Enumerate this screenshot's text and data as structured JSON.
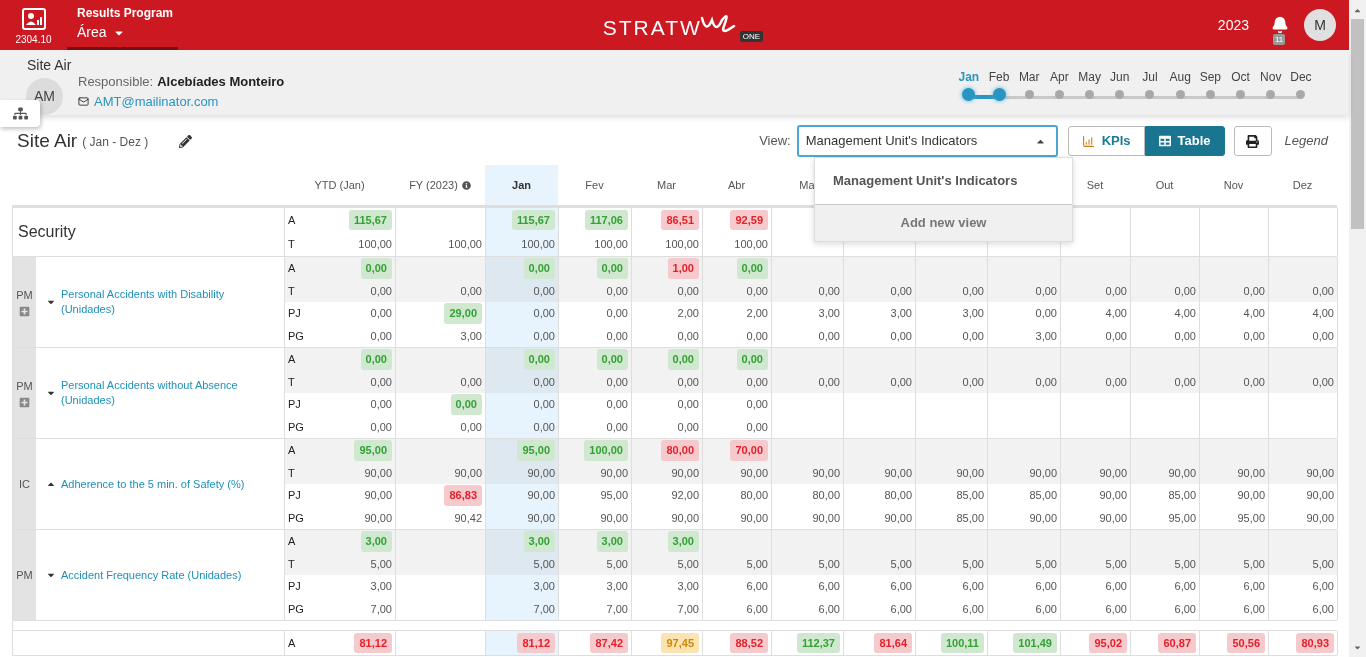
{
  "header": {
    "app_code": "2304.10",
    "program": "Results Program",
    "area": "Área",
    "logo_text": "STRATW",
    "logo_badge": "ONE",
    "year": "2023",
    "notifications": "11",
    "user_initial": "M"
  },
  "unit": {
    "name": "Site Air",
    "initials": "AM",
    "responsible_label": "Responsible:",
    "responsible": "Alcebíades Monteiro",
    "email": "AMT@mailinator.com"
  },
  "timeline": [
    {
      "label": "Jan",
      "selected": true,
      "in_range": true
    },
    {
      "label": "Feb",
      "selected": false,
      "in_range": true
    },
    {
      "label": "Mar",
      "selected": false,
      "in_range": false
    },
    {
      "label": "Apr",
      "selected": false,
      "in_range": false
    },
    {
      "label": "May",
      "selected": false,
      "in_range": false
    },
    {
      "label": "Jun",
      "selected": false,
      "in_range": false
    },
    {
      "label": "Jul",
      "selected": false,
      "in_range": false
    },
    {
      "label": "Aug",
      "selected": false,
      "in_range": false
    },
    {
      "label": "Sep",
      "selected": false,
      "in_range": false
    },
    {
      "label": "Oct",
      "selected": false,
      "in_range": false
    },
    {
      "label": "Nov",
      "selected": false,
      "in_range": false
    },
    {
      "label": "Dec",
      "selected": false,
      "in_range": false
    }
  ],
  "page": {
    "title": "Site Air",
    "period": "( Jan - Dez )"
  },
  "view": {
    "label": "View:",
    "value": "Management Unit's Indicators",
    "expanded": true,
    "options": [
      "Management Unit's Indicators"
    ],
    "add_label": "Add new view"
  },
  "modes": [
    {
      "label": "KPIs",
      "kind": "kpis",
      "selected": false
    },
    {
      "label": "Table",
      "kind": "table",
      "selected": true
    }
  ],
  "legend": "Legend",
  "table": {
    "columns": [
      {
        "label": "YTD (Jan)",
        "selected": false
      },
      {
        "label": "FY (2023)",
        "selected": false,
        "info": true
      },
      {
        "label": "Jan",
        "selected": true
      },
      {
        "label": "Fev",
        "selected": false
      },
      {
        "label": "Mar",
        "selected": false
      },
      {
        "label": "Abr",
        "selected": false
      },
      {
        "label": "Ma",
        "selected": false
      },
      {
        "selected": false
      },
      {
        "selected": false
      },
      {
        "selected": false
      },
      {
        "label": "Set",
        "selected": false
      },
      {
        "label": "Out",
        "selected": false
      },
      {
        "label": "Nov",
        "selected": false
      },
      {
        "label": "Dez",
        "selected": false
      }
    ],
    "blocks": [
      {
        "kind": "group",
        "name": "Security",
        "rows": [
          {
            "label": "A",
            "cells": [
              {
                "v": "115,67",
                "kind": "good"
              },
              null,
              {
                "v": "115,67",
                "kind": "good"
              },
              {
                "v": "117,06",
                "kind": "good"
              },
              {
                "v": "86,51",
                "kind": "bad"
              },
              {
                "v": "92,59",
                "kind": "bad"
              },
              null,
              null,
              null,
              null,
              null,
              null,
              null,
              null
            ]
          },
          {
            "label": "T",
            "cells": [
              "100,00",
              "100,00",
              "100,00",
              "100,00",
              "100,00",
              "100,00",
              null,
              null,
              null,
              null,
              null,
              null,
              null,
              null
            ]
          }
        ]
      },
      {
        "kind": "indicator",
        "type": "PM",
        "plus": true,
        "expanded": true,
        "name": "Personal Accidents with Disability (Unidades)",
        "rows": [
          {
            "label": "A",
            "cells": [
              {
                "v": "0,00",
                "kind": "good"
              },
              null,
              {
                "v": "0,00",
                "kind": "good"
              },
              {
                "v": "0,00",
                "kind": "good"
              },
              {
                "v": "1,00",
                "kind": "bad"
              },
              {
                "v": "0,00",
                "kind": "good"
              },
              null,
              null,
              null,
              null,
              null,
              null,
              null,
              null
            ]
          },
          {
            "label": "T",
            "cells": [
              "0,00",
              "0,00",
              "0,00",
              "0,00",
              "0,00",
              "0,00",
              "0,00",
              "0,00",
              "0,00",
              "0,00",
              "0,00",
              "0,00",
              "0,00",
              "0,00"
            ]
          },
          {
            "label": "PJ",
            "cells": [
              "0,00",
              {
                "v": "29,00",
                "kind": "good"
              },
              "0,00",
              "0,00",
              "2,00",
              "2,00",
              "3,00",
              "3,00",
              "3,00",
              "0,00",
              "4,00",
              "4,00",
              "4,00",
              "4,00"
            ]
          },
          {
            "label": "PG",
            "cells": [
              "0,00",
              "3,00",
              "0,00",
              "0,00",
              "0,00",
              "0,00",
              "0,00",
              "0,00",
              "0,00",
              "3,00",
              "0,00",
              "0,00",
              "0,00",
              "0,00"
            ]
          }
        ]
      },
      {
        "kind": "indicator",
        "type": "PM",
        "plus": true,
        "expanded": true,
        "name": "Personal Accidents without Absence (Unidades)",
        "rows": [
          {
            "label": "A",
            "cells": [
              {
                "v": "0,00",
                "kind": "good"
              },
              null,
              {
                "v": "0,00",
                "kind": "good"
              },
              {
                "v": "0,00",
                "kind": "good"
              },
              {
                "v": "0,00",
                "kind": "good"
              },
              {
                "v": "0,00",
                "kind": "good"
              },
              null,
              null,
              null,
              null,
              null,
              null,
              null,
              null
            ]
          },
          {
            "label": "T",
            "cells": [
              "0,00",
              "0,00",
              "0,00",
              "0,00",
              "0,00",
              "0,00",
              "0,00",
              "0,00",
              "0,00",
              "0,00",
              "0,00",
              "0,00",
              "0,00",
              "0,00"
            ]
          },
          {
            "label": "PJ",
            "cells": [
              "0,00",
              {
                "v": "0,00",
                "kind": "good"
              },
              "0,00",
              "0,00",
              "0,00",
              "0,00",
              null,
              null,
              null,
              null,
              null,
              null,
              null,
              null
            ]
          },
          {
            "label": "PG",
            "cells": [
              "0,00",
              "0,00",
              "0,00",
              "0,00",
              "0,00",
              "0,00",
              null,
              null,
              null,
              null,
              null,
              null,
              null,
              null
            ]
          }
        ]
      },
      {
        "kind": "indicator",
        "type": "IC",
        "plus": false,
        "expanded": false,
        "name": "Adherence to the 5 min. of Safety (%)",
        "rows": [
          {
            "label": "A",
            "cells": [
              {
                "v": "95,00",
                "kind": "good"
              },
              null,
              {
                "v": "95,00",
                "kind": "good"
              },
              {
                "v": "100,00",
                "kind": "good"
              },
              {
                "v": "80,00",
                "kind": "bad"
              },
              {
                "v": "70,00",
                "kind": "bad"
              },
              null,
              null,
              null,
              null,
              null,
              null,
              null,
              null
            ]
          },
          {
            "label": "T",
            "cells": [
              "90,00",
              "90,00",
              "90,00",
              "90,00",
              "90,00",
              "90,00",
              "90,00",
              "90,00",
              "90,00",
              "90,00",
              "90,00",
              "90,00",
              "90,00",
              "90,00"
            ]
          },
          {
            "label": "PJ",
            "cells": [
              "90,00",
              {
                "v": "86,83",
                "kind": "bad"
              },
              "90,00",
              "95,00",
              "92,00",
              "80,00",
              "80,00",
              "80,00",
              "85,00",
              "85,00",
              "90,00",
              "85,00",
              "90,00",
              "90,00"
            ]
          },
          {
            "label": "PG",
            "cells": [
              "90,00",
              "90,42",
              "90,00",
              "90,00",
              "90,00",
              "90,00",
              "90,00",
              "90,00",
              "85,00",
              "90,00",
              "90,00",
              "95,00",
              "95,00",
              "90,00"
            ]
          }
        ]
      },
      {
        "kind": "indicator",
        "type": "PM",
        "plus": false,
        "expanded": true,
        "name": "Accident Frequency Rate (Unidades)",
        "rows": [
          {
            "label": "A",
            "cells": [
              {
                "v": "3,00",
                "kind": "good"
              },
              null,
              {
                "v": "3,00",
                "kind": "good"
              },
              {
                "v": "3,00",
                "kind": "good"
              },
              {
                "v": "3,00",
                "kind": "good"
              },
              null,
              null,
              null,
              null,
              null,
              null,
              null,
              null,
              null
            ]
          },
          {
            "label": "T",
            "cells": [
              "5,00",
              null,
              "5,00",
              "5,00",
              "5,00",
              "5,00",
              "5,00",
              "5,00",
              "5,00",
              "5,00",
              "5,00",
              "5,00",
              "5,00",
              "5,00"
            ]
          },
          {
            "label": "PJ",
            "cells": [
              "3,00",
              null,
              "3,00",
              "3,00",
              "3,00",
              "6,00",
              "6,00",
              "6,00",
              "6,00",
              "6,00",
              "6,00",
              "6,00",
              "6,00",
              "6,00"
            ]
          },
          {
            "label": "PG",
            "cells": [
              "7,00",
              null,
              "7,00",
              "7,00",
              "7,00",
              "6,00",
              "6,00",
              "6,00",
              "6,00",
              "6,00",
              "6,00",
              "6,00",
              "6,00",
              "6,00"
            ]
          }
        ]
      },
      {
        "kind": "group",
        "rows": [
          {
            "label": "A",
            "cells": [
              {
                "v": "81,12",
                "kind": "bad"
              },
              null,
              {
                "v": "81,12",
                "kind": "bad"
              },
              {
                "v": "87,42",
                "kind": "bad"
              },
              {
                "v": "97,45",
                "kind": "warn"
              },
              {
                "v": "88,52",
                "kind": "bad"
              },
              {
                "v": "112,37",
                "kind": "good"
              },
              {
                "v": "81,64",
                "kind": "bad"
              },
              {
                "v": "100,11",
                "kind": "good"
              },
              {
                "v": "101,49",
                "kind": "good"
              },
              {
                "v": "95,02",
                "kind": "bad"
              },
              {
                "v": "60,87",
                "kind": "bad"
              },
              {
                "v": "50,56",
                "kind": "bad"
              },
              {
                "v": "80,93",
                "kind": "bad"
              }
            ]
          }
        ]
      }
    ]
  }
}
